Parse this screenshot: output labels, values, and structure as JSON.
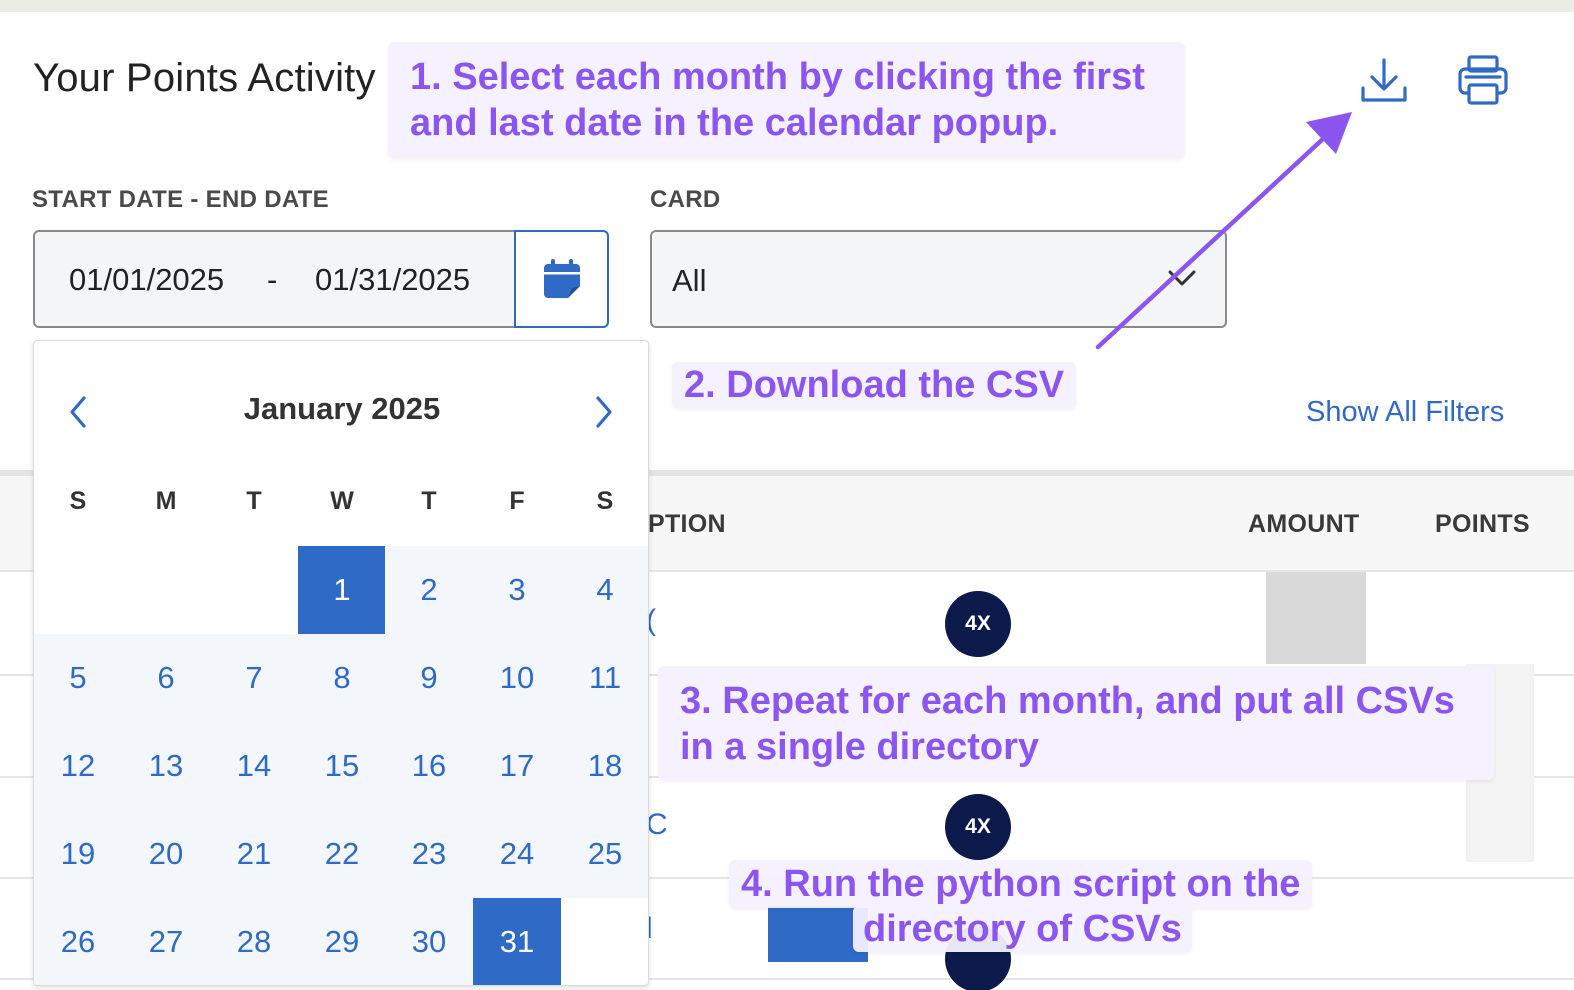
{
  "header": {
    "title": "Your Points Activity"
  },
  "toolbar": {
    "download_icon": "download-icon",
    "print_icon": "printer-icon"
  },
  "filters": {
    "date_label": "START DATE - END DATE",
    "start_date": "01/01/2025",
    "separator": "-",
    "end_date": "01/31/2025",
    "calendar_icon": "calendar-icon",
    "card_label": "CARD",
    "card_value": "All",
    "show_all": "Show All Filters"
  },
  "table": {
    "headers": [
      "PTION",
      "AMOUNT",
      "POINTS"
    ],
    "badges": [
      "4X",
      "4X"
    ]
  },
  "calendar": {
    "month": "January 2025",
    "weekdays": [
      "S",
      "M",
      "T",
      "W",
      "T",
      "F",
      "S"
    ],
    "weeks": [
      [
        "",
        "",
        "",
        "1",
        "2",
        "3",
        "4"
      ],
      [
        "5",
        "6",
        "7",
        "8",
        "9",
        "10",
        "11"
      ],
      [
        "12",
        "13",
        "14",
        "15",
        "16",
        "17",
        "18"
      ],
      [
        "19",
        "20",
        "21",
        "22",
        "23",
        "24",
        "25"
      ],
      [
        "26",
        "27",
        "28",
        "29",
        "30",
        "31",
        ""
      ]
    ],
    "selected_start": "1",
    "selected_end": "31"
  },
  "annotations": {
    "step1": "1. Select each month by clicking the first and last date in the calendar popup.",
    "step2": "2. Download the CSV",
    "step3": "3. Repeat for each month, and put all CSVs in a single directory",
    "step4_line1": "4. Run the python script on the",
    "step4_line2": "directory of CSVs"
  },
  "colors": {
    "accent": "#2f6bc6",
    "annotation_text": "#8b56f0",
    "annotation_bg": "#f4f0ff",
    "badge": "#0b1a4a"
  }
}
